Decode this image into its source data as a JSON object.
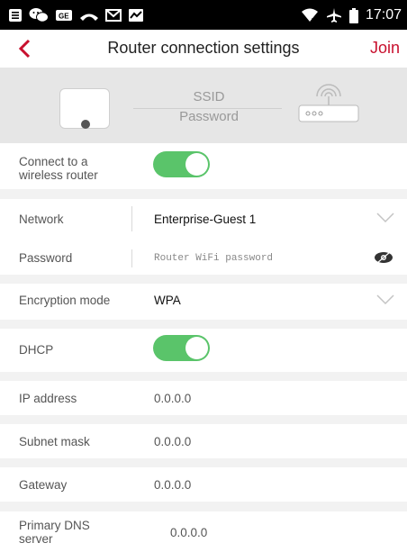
{
  "status_bar": {
    "time": "17:07",
    "left_icons": [
      "notes-icon",
      "wechat-icon",
      "ge-icon",
      "missed-call-icon",
      "mail-icon",
      "activity-icon"
    ],
    "right_icons": [
      "wifi-icon",
      "airplane-icon",
      "battery-icon"
    ]
  },
  "header": {
    "title": "Router connection settings",
    "join_label": "Join",
    "accent_color": "#c8102e"
  },
  "banner": {
    "ssid_label": "SSID",
    "password_label": "Password"
  },
  "form": {
    "connect": {
      "label": "Connect to a wireless router",
      "enabled": true
    },
    "network": {
      "label": "Network",
      "value": "Enterprise-Guest 1"
    },
    "password": {
      "label": "Password",
      "placeholder": "Router WiFi password"
    },
    "encryption": {
      "label": "Encryption mode",
      "value": "WPA"
    },
    "dhcp": {
      "label": "DHCP",
      "enabled": true
    },
    "ip": {
      "label": "IP address",
      "value": "0.0.0.0"
    },
    "subnet": {
      "label": "Subnet mask",
      "value": "0.0.0.0"
    },
    "gateway": {
      "label": "Gateway",
      "value": "0.0.0.0"
    },
    "dns": {
      "label": "Primary DNS server",
      "value": "0.0.0.0"
    }
  },
  "colors": {
    "toggle_on": "#5ac46a"
  }
}
